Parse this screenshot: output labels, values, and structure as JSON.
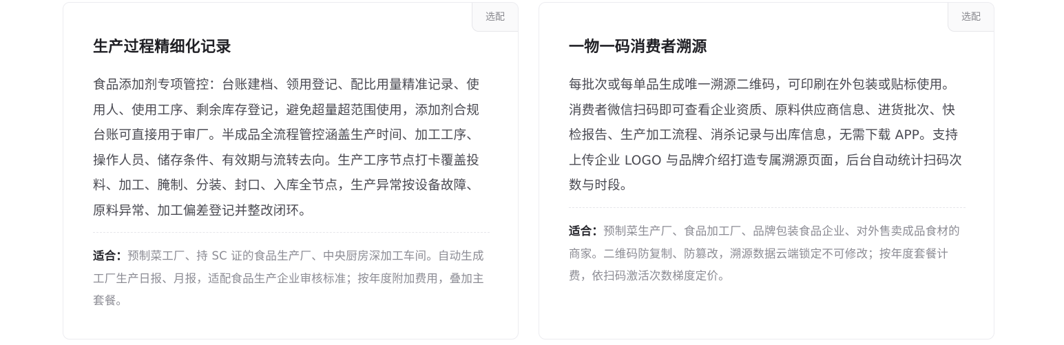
{
  "cards": [
    {
      "tag": "选配",
      "title": "生产过程精细化记录",
      "description": "食品添加剂专项管控：台账建档、领用登记、配比用量精准记录、使用人、使用工序、剩余库存登记，避免超量超范围使用，添加剂合规台账可直接用于审厂。半成品全流程管控涵盖生产时间、加工工序、操作人员、储存条件、有效期与流转去向。生产工序节点打卡覆盖投料、加工、腌制、分装、封口、入库全节点，生产异常按设备故障、原料异常、加工偏差登记并整改闭环。",
      "fit_label": "适合：",
      "fit_text": "预制菜工厂、持 SC 证的食品生产厂、中央厨房深加工车间。自动生成工厂生产日报、月报，适配食品生产企业审核标准；按年度附加费用，叠加主套餐。"
    },
    {
      "tag": "选配",
      "title": "一物一码消费者溯源",
      "description": "每批次或每单品生成唯一溯源二维码，可印刷在外包装或贴标使用。消费者微信扫码即可查看企业资质、原料供应商信息、进货批次、快检报告、生产加工流程、消杀记录与出库信息，无需下载 APP。支持上传企业 LOGO 与品牌介绍打造专属溯源页面，后台自动统计扫码次数与时段。",
      "fit_label": "适合：",
      "fit_text": "预制菜生产厂、食品加工厂、品牌包装食品企业、对外售卖成品食材的商家。二维码防复制、防篡改，溯源数据云端锁定不可修改；按年度套餐计费，依扫码激活次数梯度定价。"
    }
  ]
}
